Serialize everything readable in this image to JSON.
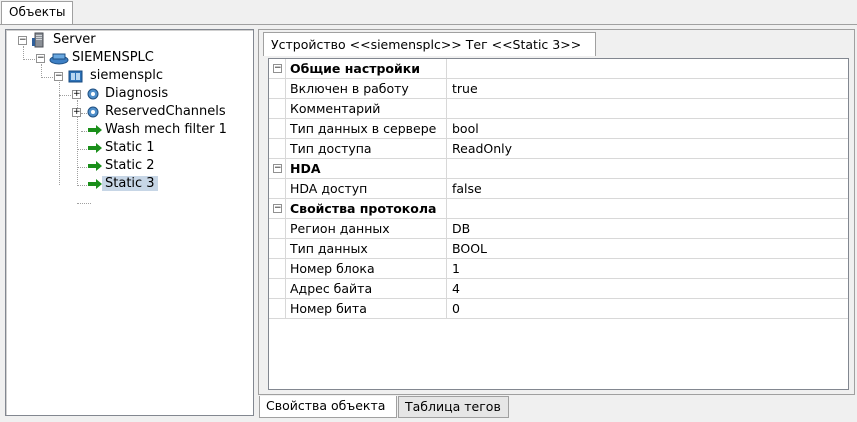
{
  "window": {
    "top_tab": "Объекты"
  },
  "tree": {
    "items": [
      {
        "label": "Server"
      },
      {
        "label": "SIEMENSPLC"
      },
      {
        "label": "siemensplc"
      },
      {
        "label": "Diagnosis"
      },
      {
        "label": "ReservedChannels"
      },
      {
        "label": "Wash mech filter 1"
      },
      {
        "label": "Static 1"
      },
      {
        "label": "Static 2"
      },
      {
        "label": "Static 3",
        "selected": true
      }
    ]
  },
  "detail_tab": "Устройство <<siemensplc>> Тег  <<Static 3>>",
  "properties": {
    "general": {
      "title": "Общие настройки",
      "rows": [
        {
          "name": "Включен в работу",
          "value": "true"
        },
        {
          "name": "Комментарий",
          "value": ""
        },
        {
          "name": "Тип данных в сервере",
          "value": "bool"
        },
        {
          "name": "Тип доступа",
          "value": "ReadOnly"
        }
      ]
    },
    "hda": {
      "title": "HDA",
      "rows": [
        {
          "name": "HDA доступ",
          "value": "false"
        }
      ]
    },
    "protocol": {
      "title": "Свойства протокола",
      "rows": [
        {
          "name": "Регион данных",
          "value": "DB"
        },
        {
          "name": "Тип данных",
          "value": "BOOL"
        },
        {
          "name": "Номер блока",
          "value": "1"
        },
        {
          "name": "Адрес байта",
          "value": "4"
        },
        {
          "name": "Номер бита",
          "value": "0"
        }
      ]
    }
  },
  "bottom_tabs": {
    "object_properties": "Свойства объекта",
    "tag_table": "Таблица тегов"
  },
  "glyphs": {
    "minus": "−",
    "plus": "+"
  },
  "colors": {
    "selection": "#c7d6e6",
    "tag_arrow": "#1a8f1a"
  }
}
